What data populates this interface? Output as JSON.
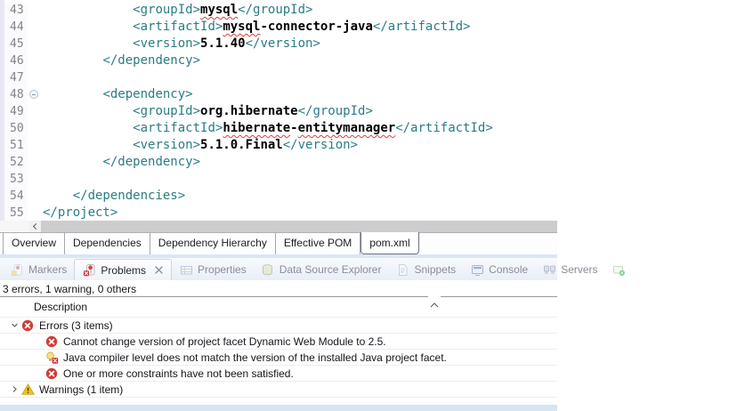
{
  "colors": {
    "xml_tag": "#2b7c85",
    "error_red": "#cf3e36",
    "warning_amber": "#f2c01e",
    "squiggle_red": "#dd4036"
  },
  "editor": {
    "active_tab": "pom.xml",
    "lines": [
      {
        "num": "43",
        "indent": 3,
        "parts": [
          {
            "t": "tag",
            "x": "<groupId>"
          },
          {
            "t": "val",
            "x": "mysql",
            "sq": true
          },
          {
            "t": "tag",
            "x": "</groupId>"
          }
        ]
      },
      {
        "num": "44",
        "indent": 3,
        "parts": [
          {
            "t": "tag",
            "x": "<artifactId>"
          },
          {
            "t": "val",
            "x": "mysql",
            "sq": true
          },
          {
            "t": "val",
            "x": "-connector-java"
          },
          {
            "t": "tag",
            "x": "</artifactId>"
          }
        ]
      },
      {
        "num": "45",
        "indent": 3,
        "parts": [
          {
            "t": "tag",
            "x": "<version>"
          },
          {
            "t": "val",
            "x": "5.1.40"
          },
          {
            "t": "tag",
            "x": "</version>"
          }
        ]
      },
      {
        "num": "46",
        "indent": 2,
        "parts": [
          {
            "t": "tag",
            "x": "</dependency>"
          }
        ]
      },
      {
        "num": "47",
        "indent": 0,
        "parts": []
      },
      {
        "num": "48",
        "indent": 2,
        "fold": true,
        "parts": [
          {
            "t": "tag",
            "x": "<dependency>"
          }
        ]
      },
      {
        "num": "49",
        "indent": 3,
        "parts": [
          {
            "t": "tag",
            "x": "<groupId>"
          },
          {
            "t": "val",
            "x": "org.hibernate"
          },
          {
            "t": "tag",
            "x": "</groupId>"
          }
        ]
      },
      {
        "num": "50",
        "indent": 3,
        "parts": [
          {
            "t": "tag",
            "x": "<artifactId>"
          },
          {
            "t": "val",
            "x": "hibernate",
            "sq": true
          },
          {
            "t": "val",
            "x": "-"
          },
          {
            "t": "val",
            "x": "entitymanager",
            "sq": true
          },
          {
            "t": "tag",
            "x": "</artifactId>"
          }
        ]
      },
      {
        "num": "51",
        "indent": 3,
        "parts": [
          {
            "t": "tag",
            "x": "<version>"
          },
          {
            "t": "val",
            "x": "5.1.0.Final"
          },
          {
            "t": "tag",
            "x": "</version>"
          }
        ]
      },
      {
        "num": "52",
        "indent": 2,
        "parts": [
          {
            "t": "tag",
            "x": "</dependency>"
          }
        ]
      },
      {
        "num": "53",
        "indent": 0,
        "parts": []
      },
      {
        "num": "54",
        "indent": 1,
        "parts": [
          {
            "t": "tag",
            "x": "</dependencies>"
          }
        ]
      },
      {
        "num": "55",
        "indent": 0,
        "parts": [
          {
            "t": "tag",
            "x": "</project>"
          }
        ]
      }
    ]
  },
  "editor_tabs": [
    {
      "label": "Overview"
    },
    {
      "label": "Dependencies"
    },
    {
      "label": "Dependency Hierarchy"
    },
    {
      "label": "Effective POM"
    },
    {
      "label": "pom.xml",
      "active": true
    }
  ],
  "view_tabs": [
    {
      "label": "Markers",
      "icon": "markers-icon"
    },
    {
      "label": "Problems",
      "icon": "problems-icon",
      "active": true,
      "closable": true
    },
    {
      "label": "Properties",
      "icon": "properties-icon"
    },
    {
      "label": "Data Source Explorer",
      "icon": "data-source-icon"
    },
    {
      "label": "Snippets",
      "icon": "snippets-icon"
    },
    {
      "label": "Console",
      "icon": "console-icon"
    },
    {
      "label": "Servers",
      "icon": "servers-icon"
    },
    {
      "label": "",
      "icon": "view-icon"
    }
  ],
  "problems": {
    "summary": "3 errors, 1 warning, 0 others",
    "column_header": "Description",
    "rows": [
      {
        "level": 1,
        "expander": "open",
        "icon": "error-icon",
        "text": "Errors (3 items)"
      },
      {
        "level": 2,
        "icon": "error-icon",
        "text": "Cannot change version of project facet Dynamic Web Module to 2.5."
      },
      {
        "level": 2,
        "icon": "quickfix-error-icon",
        "text": "Java compiler level does not match the version of the installed Java project facet."
      },
      {
        "level": 2,
        "icon": "error-icon",
        "text": "One or more constraints have not been satisfied."
      },
      {
        "level": 1,
        "expander": "closed",
        "icon": "warning-icon",
        "text": "Warnings (1 item)"
      }
    ]
  }
}
